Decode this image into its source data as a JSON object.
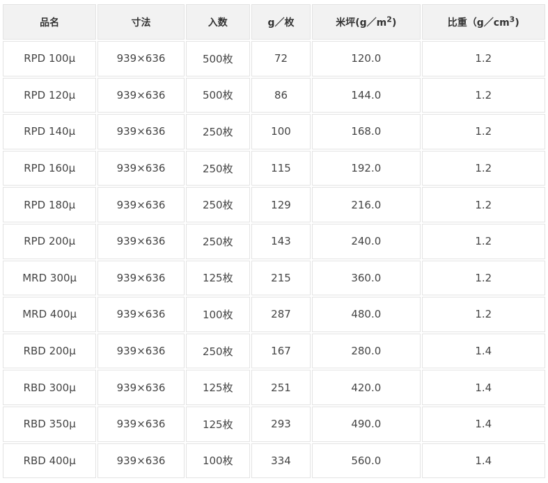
{
  "table": {
    "headers": {
      "name": "品名",
      "size": "寸法",
      "quantity": "入数",
      "gsheet": "g／枚",
      "basis_main": "米坪(g／m",
      "basis_sup": "2",
      "basis_end": ")",
      "density_main": "比重（g／cm",
      "density_sup": "3",
      "density_end": ")"
    },
    "rows": [
      {
        "name": "RPD 100μ",
        "size": "939×636",
        "quantity": "500枚",
        "gsheet": "72",
        "basis": "120.0",
        "density": "1.2"
      },
      {
        "name": "RPD 120μ",
        "size": "939×636",
        "quantity": "500枚",
        "gsheet": "86",
        "basis": "144.0",
        "density": "1.2"
      },
      {
        "name": "RPD 140μ",
        "size": "939×636",
        "quantity": "250枚",
        "gsheet": "100",
        "basis": "168.0",
        "density": "1.2"
      },
      {
        "name": "RPD 160μ",
        "size": "939×636",
        "quantity": "250枚",
        "gsheet": "115",
        "basis": "192.0",
        "density": "1.2"
      },
      {
        "name": "RPD 180μ",
        "size": "939×636",
        "quantity": "250枚",
        "gsheet": "129",
        "basis": "216.0",
        "density": "1.2"
      },
      {
        "name": "RPD 200μ",
        "size": "939×636",
        "quantity": "250枚",
        "gsheet": "143",
        "basis": "240.0",
        "density": "1.2"
      },
      {
        "name": "MRD 300μ",
        "size": "939×636",
        "quantity": "125枚",
        "gsheet": "215",
        "basis": "360.0",
        "density": "1.2"
      },
      {
        "name": "MRD 400μ",
        "size": "939×636",
        "quantity": "100枚",
        "gsheet": "287",
        "basis": "480.0",
        "density": "1.2"
      },
      {
        "name": "RBD 200μ",
        "size": "939×636",
        "quantity": "250枚",
        "gsheet": "167",
        "basis": "280.0",
        "density": "1.4"
      },
      {
        "name": "RBD 300μ",
        "size": "939×636",
        "quantity": "125枚",
        "gsheet": "251",
        "basis": "420.0",
        "density": "1.4"
      },
      {
        "name": "RBD 350μ",
        "size": "939×636",
        "quantity": "125枚",
        "gsheet": "293",
        "basis": "490.0",
        "density": "1.4"
      },
      {
        "name": "RBD 400μ",
        "size": "939×636",
        "quantity": "100枚",
        "gsheet": "334",
        "basis": "560.0",
        "density": "1.4"
      }
    ]
  },
  "colors": {
    "header_bg": "#f2f2f2",
    "border": "#e3e3e3",
    "text": "#444444"
  }
}
